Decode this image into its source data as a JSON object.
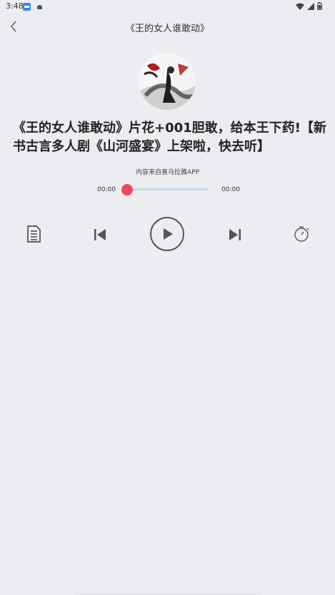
{
  "status_bar": {
    "time": "3:48"
  },
  "nav": {
    "title": "《王的女人谁敢动》"
  },
  "episode": {
    "headline": "《王的女人谁敢动》片花+001胆敢，给本王下药!【新书古言多人剧《山河盛宴》上架啦，快去听】",
    "source_note": "内容来自喜马拉雅APP"
  },
  "player": {
    "current_time": "00:00",
    "total_time": "00:00",
    "progress": 0,
    "accent_color": "#f0465a",
    "track_color": "#c4d7ea"
  },
  "controls": {
    "playlist_icon": "playlist-icon",
    "previous_icon": "skip-previous-icon",
    "play_icon": "play-icon",
    "next_icon": "skip-next-icon",
    "timer_icon": "timer-icon"
  }
}
